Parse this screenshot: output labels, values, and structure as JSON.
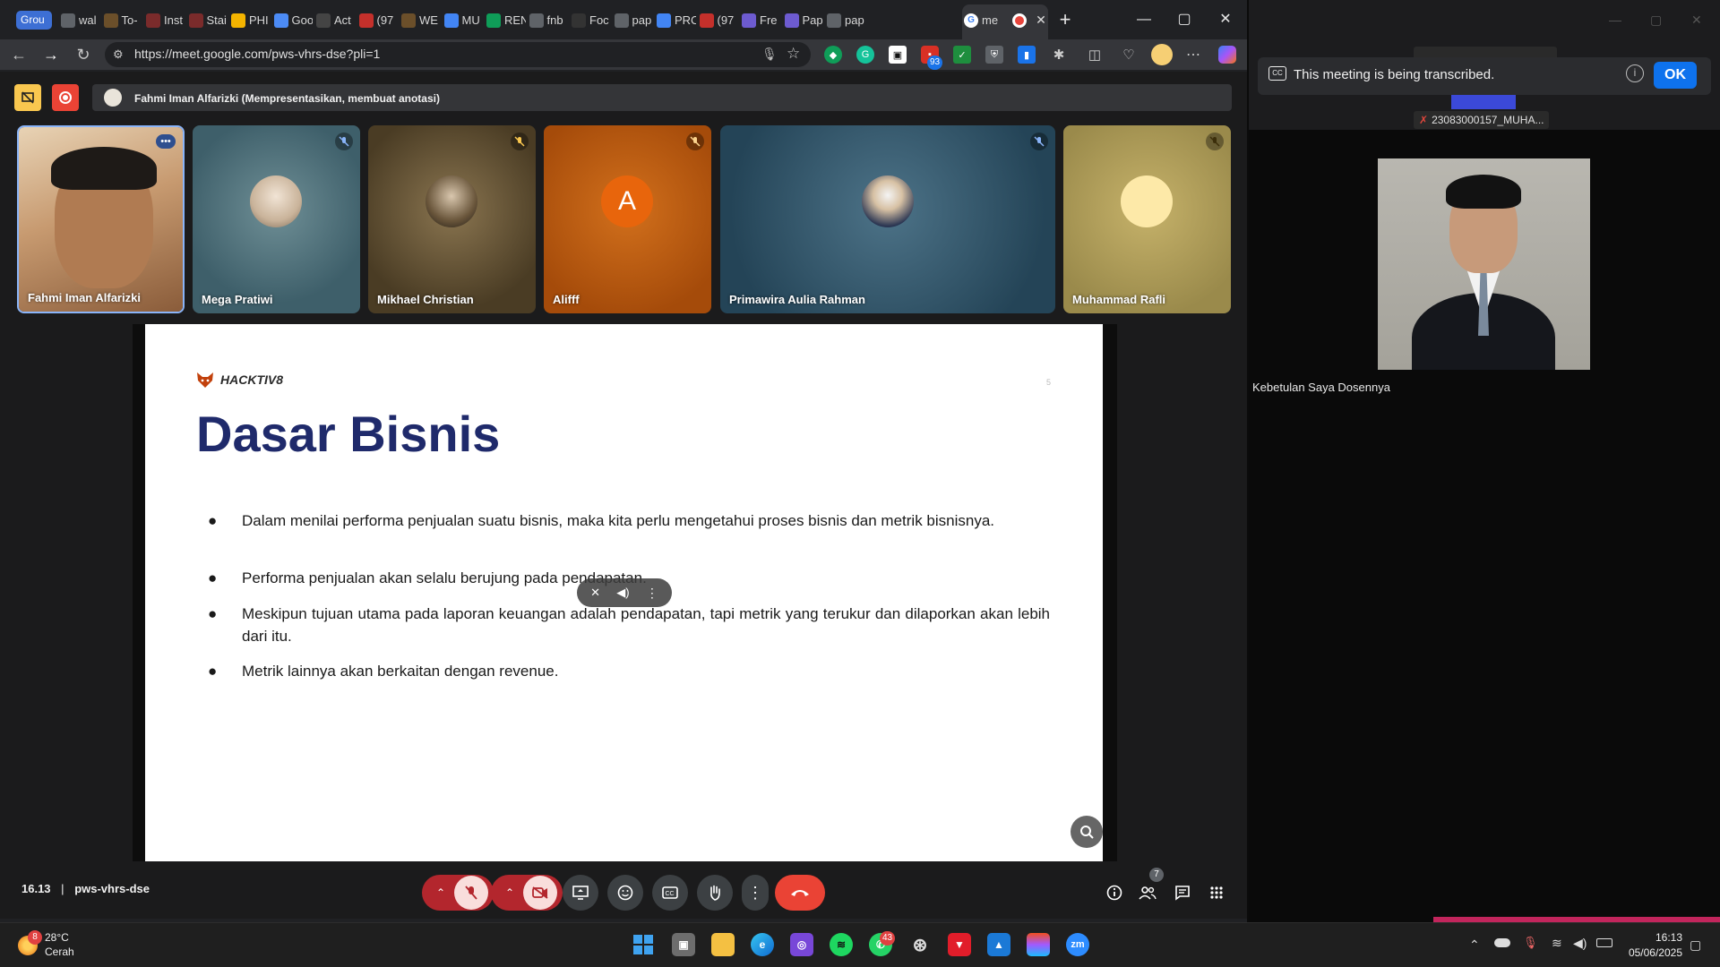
{
  "browser": {
    "tab_group": "Grou",
    "tabs": [
      {
        "label": "wal",
        "icon": "google-icon",
        "color": "#5f6368"
      },
      {
        "label": "To-",
        "icon": "image-icon",
        "color": "#6b4f2a"
      },
      {
        "label": "Inst",
        "icon": "app-icon",
        "color": "#7a2b2b"
      },
      {
        "label": "Stai",
        "icon": "app-icon",
        "color": "#7a2b2b"
      },
      {
        "label": "PHI",
        "icon": "sheet-icon",
        "color": "#f4b400"
      },
      {
        "label": "Goo",
        "icon": "gemini-icon",
        "color": "#4c8bf5"
      },
      {
        "label": "Act",
        "icon": "github-icon",
        "color": "#444444"
      },
      {
        "label": "(97",
        "icon": "youtube-icon",
        "color": "#c4302b"
      },
      {
        "label": "WE",
        "icon": "image-icon",
        "color": "#6b4f2a"
      },
      {
        "label": "MU",
        "icon": "doc-icon",
        "color": "#4285f4"
      },
      {
        "label": "REN",
        "icon": "drive-icon",
        "color": "#0f9d58"
      },
      {
        "label": "fnb",
        "icon": "google-icon",
        "color": "#5f6368"
      },
      {
        "label": "Foc",
        "icon": "st-icon",
        "color": "#333333"
      },
      {
        "label": "pap",
        "icon": "google-icon",
        "color": "#5f6368"
      },
      {
        "label": "PRC",
        "icon": "doc-icon",
        "color": "#4285f4"
      },
      {
        "label": "(97",
        "icon": "youtube-icon",
        "color": "#c4302b"
      },
      {
        "label": "Fre",
        "icon": "perplexity-icon",
        "color": "#6d5bd0"
      },
      {
        "label": "Pap",
        "icon": "perplexity-icon",
        "color": "#6d5bd0"
      },
      {
        "label": "pap",
        "icon": "google-icon",
        "color": "#5f6368"
      }
    ],
    "active_tab": "me",
    "url": "https://meet.google.com/pws-vhrs-dse?pli=1",
    "ext_badge": "93"
  },
  "meet": {
    "presenter_banner": "Fahmi Iman Alfarizki (Mempresentasikan, membuat anotasi)",
    "participants": [
      {
        "name": "Fahmi Iman Alfarizki",
        "kind": "video",
        "bg": "#c9a77e"
      },
      {
        "name": "Mega Pratiwi",
        "kind": "photo",
        "bg": "#3e5f6a"
      },
      {
        "name": "Mikhael Christian",
        "kind": "photo",
        "bg": "#5a4a2e"
      },
      {
        "name": "Alifff",
        "kind": "letter",
        "letter": "A",
        "bg": "#c25a0f",
        "avatar_color": "#e8650c"
      },
      {
        "name": "Primawira Aulia Rahman",
        "kind": "photo",
        "bg": "#2c4f66"
      },
      {
        "name": "Muhammad Rafli",
        "kind": "circle",
        "bg": "#b09f5a",
        "avatar_color": "#fde9a8"
      }
    ],
    "slide": {
      "brand": "HACKTIV8",
      "title": "Dasar Bisnis",
      "page_number": "5",
      "bullets": [
        "Dalam menilai performa penjualan suatu bisnis, maka kita perlu mengetahui proses bisnis dan metrik bisnisnya.",
        "Performa penjualan akan selalu berujung pada pendapatan.",
        "Meskipun tujuan utama pada laporan keuangan adalah pendapatan, tapi metrik yang terukur dan dilaporkan akan lebih dari itu.",
        "Metrik lainnya akan berkaitan dengan revenue."
      ]
    },
    "time": "16.13",
    "separator": "|",
    "meeting_code": "pws-vhrs-dse",
    "people_count": "7"
  },
  "zoom": {
    "transcription_notice": "This meeting is being transcribed.",
    "ok_label": "OK",
    "thumbnail_label": "23083000157_MUHA...",
    "speaker_name": "Kebetulan Saya Dosennya"
  },
  "taskbar": {
    "weather_badge": "8",
    "temperature": "28°C",
    "condition": "Cerah",
    "whatsapp_badge": "43",
    "time": "16:13",
    "date": "05/06/2025"
  }
}
